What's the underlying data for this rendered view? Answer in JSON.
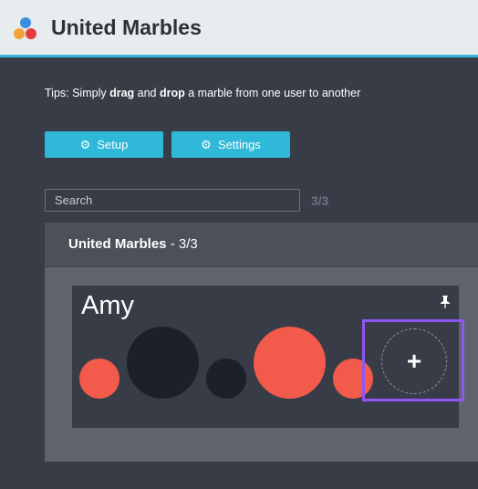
{
  "header": {
    "title": "United Marbles"
  },
  "tips": {
    "prefix": "Tips: Simply ",
    "drag": "drag",
    "and": " and ",
    "drop": "drop",
    "suffix": " a marble from one user to another"
  },
  "toolbar": {
    "setup_label": "Setup",
    "settings_label": "Settings"
  },
  "search": {
    "placeholder": "Search",
    "count": "3/3"
  },
  "panel": {
    "title": "United Marbles",
    "separator": " - ",
    "count": "3/3"
  },
  "user": {
    "name": "Amy",
    "add_label": "+",
    "marbles": [
      {
        "color": "#f25a4b",
        "size": "small"
      },
      {
        "color": "#1c2028",
        "size": "large"
      },
      {
        "color": "#1c2028",
        "size": "small"
      },
      {
        "color": "#f25a4b",
        "size": "large"
      },
      {
        "color": "#f25a4b",
        "size": "small"
      }
    ]
  },
  "colors": {
    "accent": "#2fb8d8",
    "marble_red": "#f25a4b",
    "marble_dark": "#1c2028",
    "highlight": "#9055f5"
  }
}
